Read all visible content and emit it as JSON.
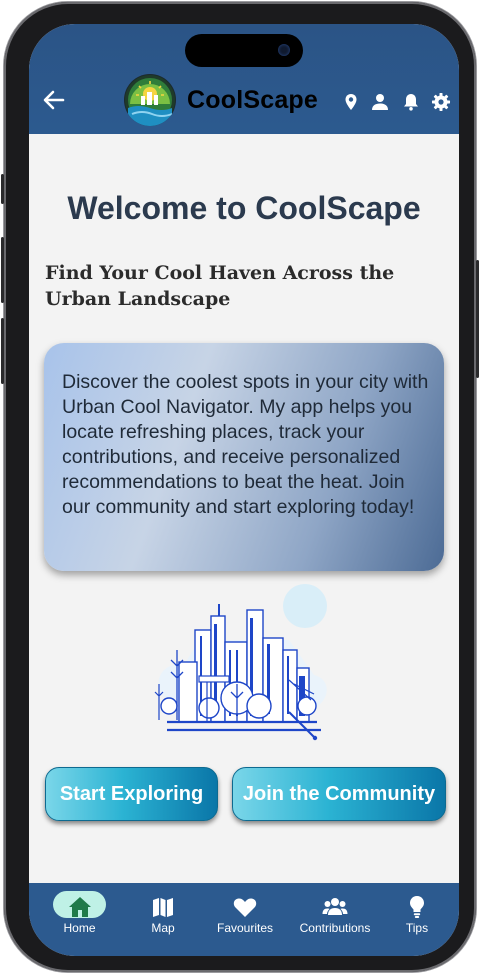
{
  "app": {
    "name": "CoolScape",
    "title": "Welcome to CoolScape",
    "subtitle": "Find Your Cool Haven Across the Urban Landscape",
    "description": "Discover the coolest spots in your city with Urban Cool Navigator. My app helps you locate refreshing places, track your contributions, and receive personalized recommendations to beat the heat. Join our community and start exploring today!"
  },
  "header": {
    "icons": [
      "back-arrow-icon",
      "location-pin-icon",
      "person-icon",
      "bell-icon",
      "gear-icon"
    ]
  },
  "actions": {
    "start_label": "Start Exploring",
    "join_label": "Join the Community"
  },
  "nav": {
    "items": [
      {
        "label": "Home",
        "icon": "home-icon",
        "active": true
      },
      {
        "label": "Map",
        "icon": "map-icon",
        "active": false
      },
      {
        "label": "Favourites",
        "icon": "heart-icon",
        "active": false
      },
      {
        "label": "Contributions",
        "icon": "group-icon",
        "active": false
      },
      {
        "label": "Tips",
        "icon": "lightbulb-icon",
        "active": false
      }
    ]
  },
  "colors": {
    "header": "#2c5a8f",
    "title": "#2b3a4e",
    "button_start": "#7ad6e9",
    "button_end": "#0a76a8",
    "active_pill": "#bff1e6"
  }
}
